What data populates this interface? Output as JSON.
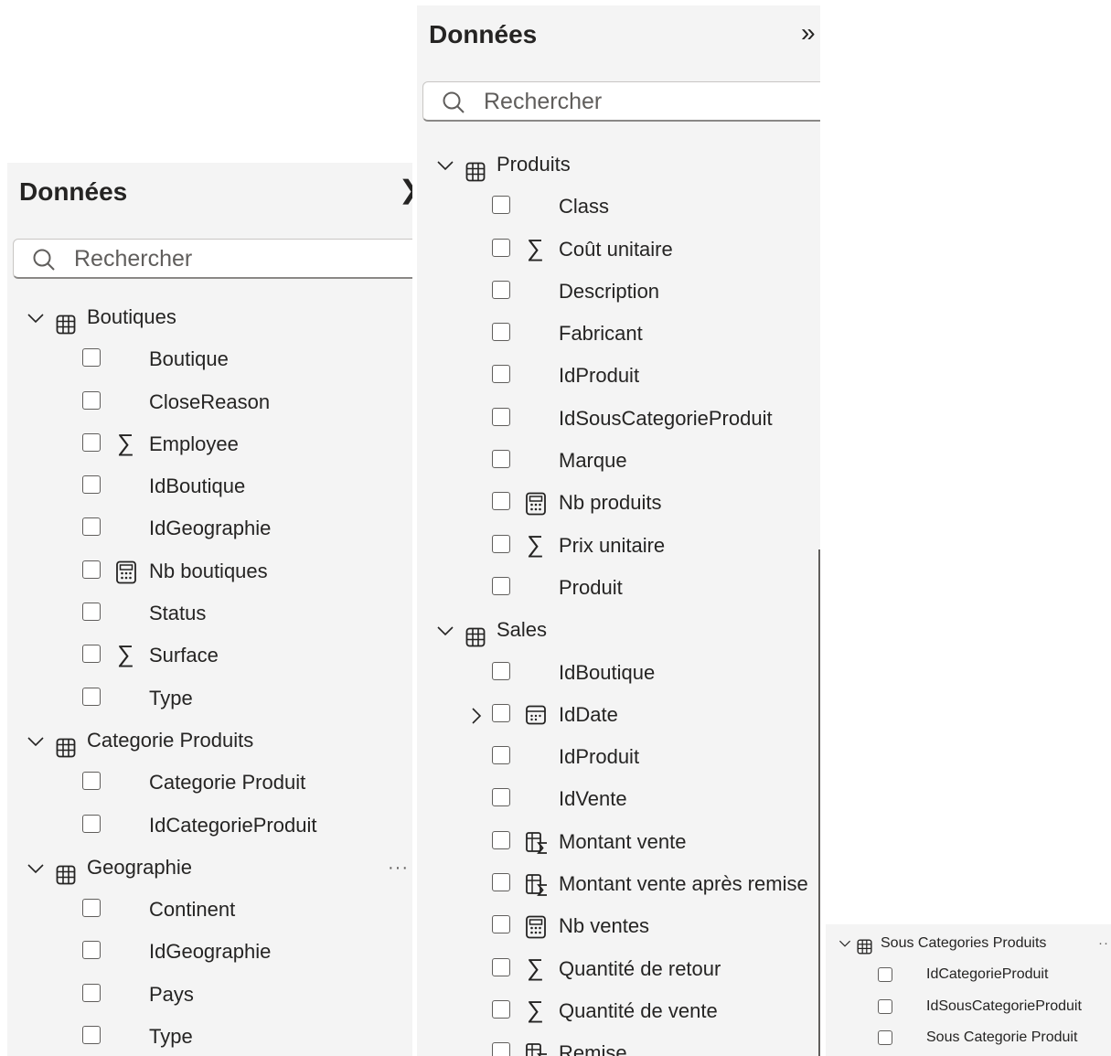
{
  "panel_left": {
    "title": "Données",
    "search_placeholder": "Rechercher",
    "tables": [
      {
        "name": "Boutiques",
        "fields": [
          {
            "label": "Boutique",
            "icon": ""
          },
          {
            "label": "CloseReason",
            "icon": ""
          },
          {
            "label": "Employee",
            "icon": "sigma-icon"
          },
          {
            "label": "IdBoutique",
            "icon": ""
          },
          {
            "label": "IdGeographie",
            "icon": ""
          },
          {
            "label": "Nb boutiques",
            "icon": "calculator-icon"
          },
          {
            "label": "Status",
            "icon": ""
          },
          {
            "label": "Surface",
            "icon": "sigma-icon"
          },
          {
            "label": "Type",
            "icon": ""
          }
        ]
      },
      {
        "name": "Categorie Produits",
        "fields": [
          {
            "label": "Categorie Produit",
            "icon": ""
          },
          {
            "label": "IdCategorieProduit",
            "icon": ""
          }
        ]
      },
      {
        "name": "Geographie",
        "more": "···",
        "fields": [
          {
            "label": "Continent",
            "icon": ""
          },
          {
            "label": "IdGeographie",
            "icon": ""
          },
          {
            "label": "Pays",
            "icon": ""
          },
          {
            "label": "Type",
            "icon": ""
          }
        ]
      }
    ]
  },
  "panel_middle": {
    "title": "Données",
    "search_placeholder": "Rechercher",
    "tables": [
      {
        "name": "Produits",
        "fields": [
          {
            "label": "Class",
            "icon": ""
          },
          {
            "label": "Coût unitaire",
            "icon": "sigma-icon"
          },
          {
            "label": "Description",
            "icon": ""
          },
          {
            "label": "Fabricant",
            "icon": ""
          },
          {
            "label": "IdProduit",
            "icon": ""
          },
          {
            "label": "IdSousCategorieProduit",
            "icon": ""
          },
          {
            "label": "Marque",
            "icon": ""
          },
          {
            "label": "Nb produits",
            "icon": "calculator-icon"
          },
          {
            "label": "Prix unitaire",
            "icon": "sigma-icon"
          },
          {
            "label": "Produit",
            "icon": ""
          }
        ]
      },
      {
        "name": "Sales",
        "fields": [
          {
            "label": "IdBoutique",
            "icon": ""
          },
          {
            "label": "IdDate",
            "icon": "calendar-icon",
            "expandable": true
          },
          {
            "label": "IdProduit",
            "icon": ""
          },
          {
            "label": "IdVente",
            "icon": ""
          },
          {
            "label": "Montant vente",
            "icon": "calc-column-icon"
          },
          {
            "label": "Montant vente après remise",
            "icon": "calc-column-icon"
          },
          {
            "label": "Nb ventes",
            "icon": "calculator-icon"
          },
          {
            "label": "Quantité de retour",
            "icon": "sigma-icon"
          },
          {
            "label": "Quantité de vente",
            "icon": "sigma-icon"
          },
          {
            "label": "Remise",
            "icon": "calc-column-icon"
          }
        ]
      }
    ]
  },
  "panel_small": {
    "tables": [
      {
        "name": "Sous Categories Produits",
        "more": "··",
        "fields": [
          {
            "label": "IdCategorieProduit",
            "icon": ""
          },
          {
            "label": "IdSousCategorieProduit",
            "icon": ""
          },
          {
            "label": "Sous Categorie Produit",
            "icon": ""
          }
        ]
      }
    ]
  }
}
